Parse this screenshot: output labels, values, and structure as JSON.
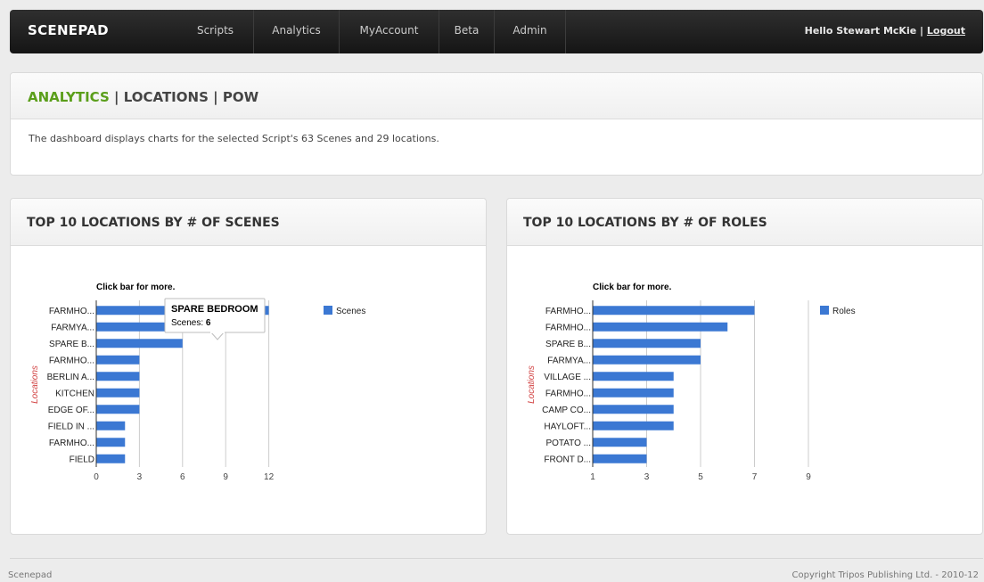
{
  "nav": {
    "brand": "SCENEPAD",
    "items": [
      "Scripts",
      "Analytics",
      "MyAccount",
      "Beta",
      "Admin"
    ],
    "greeting": "Hello Stewart McKie",
    "separator": "|",
    "logout": "Logout"
  },
  "header": {
    "section": "ANALYTICS",
    "sep1": "|",
    "locations": "LOCATIONS",
    "sep2": "|",
    "pow": "POW",
    "description": "The dashboard displays charts for the selected Script's 63 Scenes and 29 locations."
  },
  "charts_text": {
    "scenes_panel_title": "TOP 10 LOCATIONS BY # OF SCENES",
    "roles_panel_title": "TOP 10 LOCATIONS BY # OF ROLES"
  },
  "tooltip": {
    "title": "SPARE BEDROOM",
    "label": "Scenes:",
    "value": "6"
  },
  "colors": {
    "bar": "#3b78d3",
    "accent_green": "#5a9e1a",
    "axis_title": "#d13f3f"
  },
  "chart_data": [
    {
      "type": "bar",
      "orientation": "horizontal",
      "title": "Click bar for more.",
      "ylabel": "Locations",
      "xlabel": "",
      "categories": [
        "FARMHO...",
        "FARMYA...",
        "SPARE B...",
        "FARMHO...",
        "BERLIN A...",
        "KITCHEN",
        "EDGE OF...",
        "FIELD IN ...",
        "FARMHO...",
        "FIELD"
      ],
      "series": [
        {
          "name": "Scenes",
          "values": [
            12,
            10,
            6,
            3,
            3,
            3,
            3,
            2,
            2,
            2
          ]
        }
      ],
      "xticks": [
        0,
        3,
        6,
        9,
        12
      ],
      "xlim": [
        0,
        15
      ],
      "grid": true,
      "legend": "right"
    },
    {
      "type": "bar",
      "orientation": "horizontal",
      "title": "Click bar for more.",
      "ylabel": "Locations",
      "xlabel": "",
      "categories": [
        "FARMHO...",
        "FARMHO...",
        "SPARE B...",
        "FARMYA...",
        "VILLAGE ...",
        "FARMHO...",
        "CAMP CO...",
        "HAYLOFT...",
        "POTATO ...",
        "FRONT D..."
      ],
      "series": [
        {
          "name": "Roles",
          "values": [
            7,
            6,
            5,
            5,
            4,
            4,
            4,
            4,
            3,
            3
          ]
        }
      ],
      "xticks": [
        1,
        3,
        5,
        7,
        9
      ],
      "xlim": [
        1,
        9
      ],
      "grid": true,
      "legend": "right"
    }
  ],
  "footer": {
    "left": "Scenepad",
    "right": "Copyright Tripos Publishing Ltd. - 2010-12"
  }
}
